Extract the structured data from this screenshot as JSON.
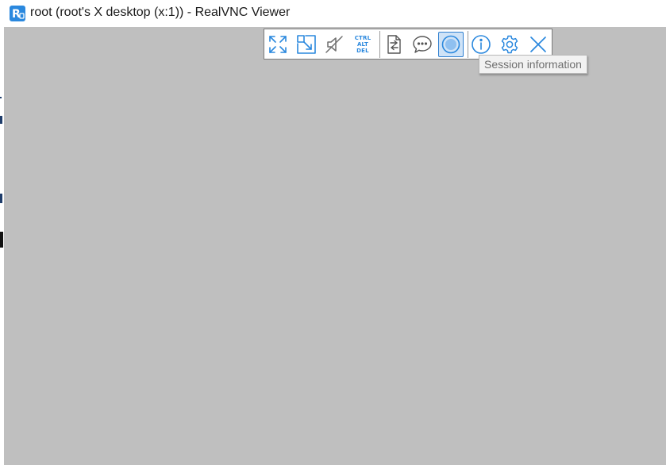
{
  "window": {
    "title": "root (root's X desktop (x:1)) - RealVNC Viewer",
    "logo_icon": "realvnc-logo-icon"
  },
  "toolbar": {
    "accent_color": "#2a88de",
    "buttons": [
      {
        "name": "full-screen-button",
        "icon": "expand-arrows-icon"
      },
      {
        "name": "scale-button",
        "icon": "scale-to-fit-icon"
      },
      {
        "name": "audio-button",
        "icon": "speaker-muted-icon"
      },
      {
        "name": "ctrl-alt-del-button",
        "icon": "ctrl-alt-del-icon",
        "lines": [
          "CTRL",
          "ALT",
          "DEL"
        ]
      },
      {
        "name": "file-transfer-button",
        "icon": "file-transfer-icon"
      },
      {
        "name": "chat-button",
        "icon": "chat-bubble-icon"
      },
      {
        "name": "record-button",
        "icon": "record-icon",
        "active": true
      },
      {
        "name": "session-info-button",
        "icon": "info-icon"
      },
      {
        "name": "properties-button",
        "icon": "gear-icon"
      },
      {
        "name": "close-session-button",
        "icon": "close-icon"
      }
    ]
  },
  "tooltip": {
    "text": "Session information"
  },
  "desktop": {
    "background_color": "#bfbfbf"
  }
}
